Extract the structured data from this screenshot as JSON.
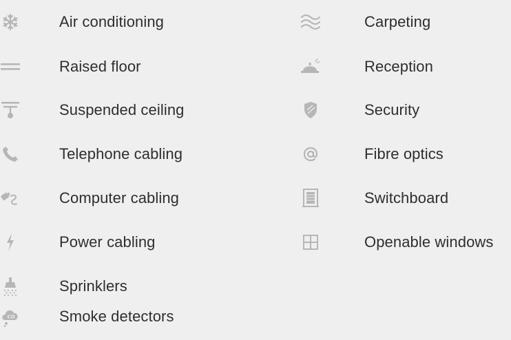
{
  "amenities": {
    "left": [
      {
        "label": "Air conditioning",
        "icon": "snowflake-icon"
      },
      {
        "label": "Raised floor",
        "icon": "raised-floor-icon"
      },
      {
        "label": "Suspended ceiling",
        "icon": "suspended-ceiling-icon"
      },
      {
        "label": "Telephone cabling",
        "icon": "telephone-icon"
      },
      {
        "label": "Computer cabling",
        "icon": "computer-cable-icon"
      },
      {
        "label": "Power cabling",
        "icon": "lightning-icon"
      },
      {
        "label": "Sprinklers",
        "icon": "sprinkler-icon"
      },
      {
        "label": "Smoke detectors",
        "icon": "smoke-detector-icon"
      }
    ],
    "right": [
      {
        "label": "Carpeting",
        "icon": "carpet-waves-icon"
      },
      {
        "label": "Reception",
        "icon": "reception-bell-icon"
      },
      {
        "label": "Security",
        "icon": "shield-icon"
      },
      {
        "label": "Fibre optics",
        "icon": "at-sign-icon"
      },
      {
        "label": "Switchboard",
        "icon": "switchboard-icon"
      },
      {
        "label": "Openable windows",
        "icon": "window-icon"
      }
    ]
  },
  "colors": {
    "background": "#efefef",
    "text": "#2e2e2e",
    "icon": "#b6b6b6"
  }
}
